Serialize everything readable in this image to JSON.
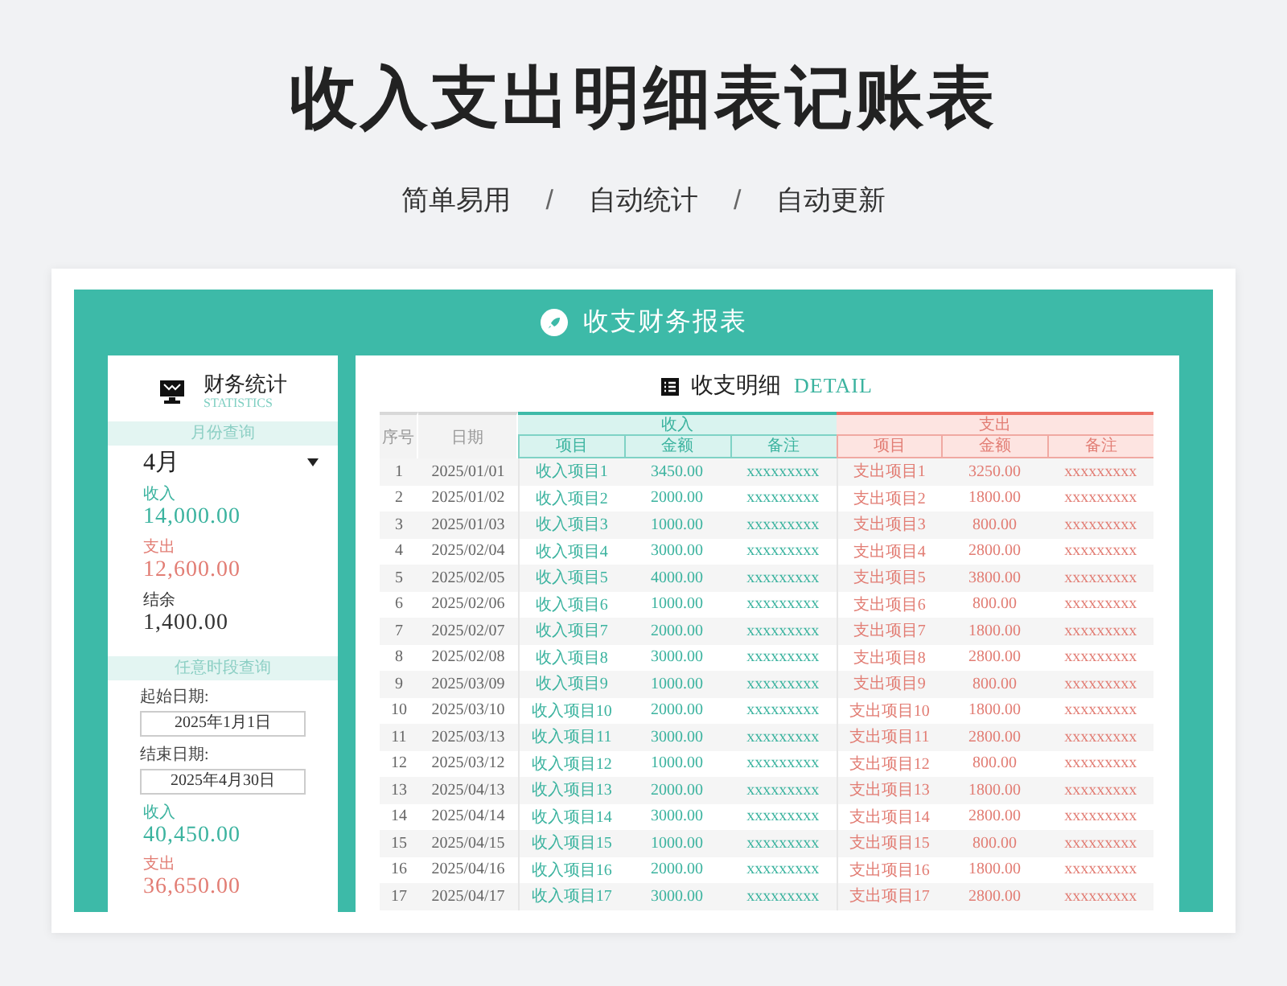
{
  "page": {
    "title": "收入支出明细表记账表",
    "subtitle": [
      {
        "kind": "label",
        "text": "简单易用"
      },
      {
        "kind": "separator",
        "text": "/"
      },
      {
        "kind": "label",
        "text": "自动统计"
      },
      {
        "kind": "separator",
        "text": "/"
      },
      {
        "kind": "label",
        "text": "自动更新"
      }
    ]
  },
  "report": {
    "title": "收支财务报表",
    "stats": {
      "title": "财务统计",
      "subtitle": "STATISTICS",
      "month_section": {
        "heading": "月份查询",
        "month": "4月",
        "figures": [
          {
            "kind": "income",
            "label": "收入",
            "value": "14,000.00"
          },
          {
            "kind": "expense",
            "label": "支出",
            "value": "12,600.00"
          },
          {
            "kind": "balance",
            "label": "结余",
            "value": "1,400.00"
          }
        ]
      },
      "range_section": {
        "heading": "任意时段查询",
        "start_label": "起始日期:",
        "start": "2025年1月1日",
        "end_label": "结束日期:",
        "end": "2025年4月30日",
        "figures": [
          {
            "kind": "income",
            "label": "收入",
            "value": "40,450.00"
          },
          {
            "kind": "expense",
            "label": "支出",
            "value": "36,650.00"
          }
        ]
      }
    },
    "detail": {
      "title": "收支明细",
      "subtitle": "DETAIL",
      "columns": {
        "index": "序号",
        "date": "日期",
        "groups": [
          {
            "kind": "income",
            "label": "收入",
            "columns": [
              "项目",
              "金额",
              "备注"
            ]
          },
          {
            "kind": "expense",
            "label": "支出",
            "columns": [
              "项目",
              "金额",
              "备注"
            ]
          }
        ]
      },
      "rows": [
        {
          "index": "1",
          "date": "2025/01/01",
          "income": [
            "收入项目1",
            "3450.00",
            "xxxxxxxxx"
          ],
          "expense": [
            "支出项目1",
            "3250.00",
            "xxxxxxxxx"
          ]
        },
        {
          "index": "2",
          "date": "2025/01/02",
          "income": [
            "收入项目2",
            "2000.00",
            "xxxxxxxxx"
          ],
          "expense": [
            "支出项目2",
            "1800.00",
            "xxxxxxxxx"
          ]
        },
        {
          "index": "3",
          "date": "2025/01/03",
          "income": [
            "收入项目3",
            "1000.00",
            "xxxxxxxxx"
          ],
          "expense": [
            "支出项目3",
            "800.00",
            "xxxxxxxxx"
          ]
        },
        {
          "index": "4",
          "date": "2025/02/04",
          "income": [
            "收入项目4",
            "3000.00",
            "xxxxxxxxx"
          ],
          "expense": [
            "支出项目4",
            "2800.00",
            "xxxxxxxxx"
          ]
        },
        {
          "index": "5",
          "date": "2025/02/05",
          "income": [
            "收入项目5",
            "4000.00",
            "xxxxxxxxx"
          ],
          "expense": [
            "支出项目5",
            "3800.00",
            "xxxxxxxxx"
          ]
        },
        {
          "index": "6",
          "date": "2025/02/06",
          "income": [
            "收入项目6",
            "1000.00",
            "xxxxxxxxx"
          ],
          "expense": [
            "支出项目6",
            "800.00",
            "xxxxxxxxx"
          ]
        },
        {
          "index": "7",
          "date": "2025/02/07",
          "income": [
            "收入项目7",
            "2000.00",
            "xxxxxxxxx"
          ],
          "expense": [
            "支出项目7",
            "1800.00",
            "xxxxxxxxx"
          ]
        },
        {
          "index": "8",
          "date": "2025/02/08",
          "income": [
            "收入项目8",
            "3000.00",
            "xxxxxxxxx"
          ],
          "expense": [
            "支出项目8",
            "2800.00",
            "xxxxxxxxx"
          ]
        },
        {
          "index": "9",
          "date": "2025/03/09",
          "income": [
            "收入项目9",
            "1000.00",
            "xxxxxxxxx"
          ],
          "expense": [
            "支出项目9",
            "800.00",
            "xxxxxxxxx"
          ]
        },
        {
          "index": "10",
          "date": "2025/03/10",
          "income": [
            "收入项目10",
            "2000.00",
            "xxxxxxxxx"
          ],
          "expense": [
            "支出项目10",
            "1800.00",
            "xxxxxxxxx"
          ]
        },
        {
          "index": "11",
          "date": "2025/03/13",
          "income": [
            "收入项目11",
            "3000.00",
            "xxxxxxxxx"
          ],
          "expense": [
            "支出项目11",
            "2800.00",
            "xxxxxxxxx"
          ]
        },
        {
          "index": "12",
          "date": "2025/03/12",
          "income": [
            "收入项目12",
            "1000.00",
            "xxxxxxxxx"
          ],
          "expense": [
            "支出项目12",
            "800.00",
            "xxxxxxxxx"
          ]
        },
        {
          "index": "13",
          "date": "2025/04/13",
          "income": [
            "收入项目13",
            "2000.00",
            "xxxxxxxxx"
          ],
          "expense": [
            "支出项目13",
            "1800.00",
            "xxxxxxxxx"
          ]
        },
        {
          "index": "14",
          "date": "2025/04/14",
          "income": [
            "收入项目14",
            "3000.00",
            "xxxxxxxxx"
          ],
          "expense": [
            "支出项目14",
            "2800.00",
            "xxxxxxxxx"
          ]
        },
        {
          "index": "15",
          "date": "2025/04/15",
          "income": [
            "收入项目15",
            "1000.00",
            "xxxxxxxxx"
          ],
          "expense": [
            "支出项目15",
            "800.00",
            "xxxxxxxxx"
          ]
        },
        {
          "index": "16",
          "date": "2025/04/16",
          "income": [
            "收入项目16",
            "2000.00",
            "xxxxxxxxx"
          ],
          "expense": [
            "支出项目16",
            "1800.00",
            "xxxxxxxxx"
          ]
        },
        {
          "index": "17",
          "date": "2025/04/17",
          "income": [
            "收入项目17",
            "3000.00",
            "xxxxxxxxx"
          ],
          "expense": [
            "支出项目17",
            "2800.00",
            "xxxxxxxxx"
          ]
        }
      ]
    }
  }
}
